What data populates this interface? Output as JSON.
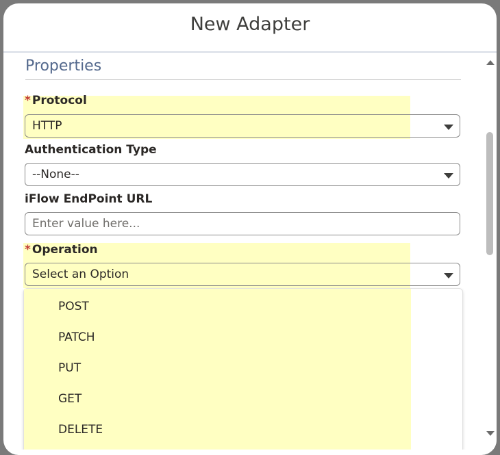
{
  "modal": {
    "title": "New Adapter"
  },
  "section": {
    "title": "Properties"
  },
  "fields": {
    "protocol": {
      "required_mark": "*",
      "label": "Protocol",
      "value": "HTTP"
    },
    "auth_type": {
      "label": "Authentication Type",
      "value": "--None--"
    },
    "endpoint_url": {
      "label": "iFlow EndPoint URL",
      "placeholder": "Enter value here..."
    },
    "operation": {
      "required_mark": "*",
      "label": "Operation",
      "value": "Select an Option",
      "options": [
        "POST",
        "PATCH",
        "PUT",
        "GET",
        "DELETE"
      ]
    }
  },
  "colors": {
    "highlight": "#ffffc2",
    "required": "#c23934",
    "section_title": "#54698d"
  }
}
